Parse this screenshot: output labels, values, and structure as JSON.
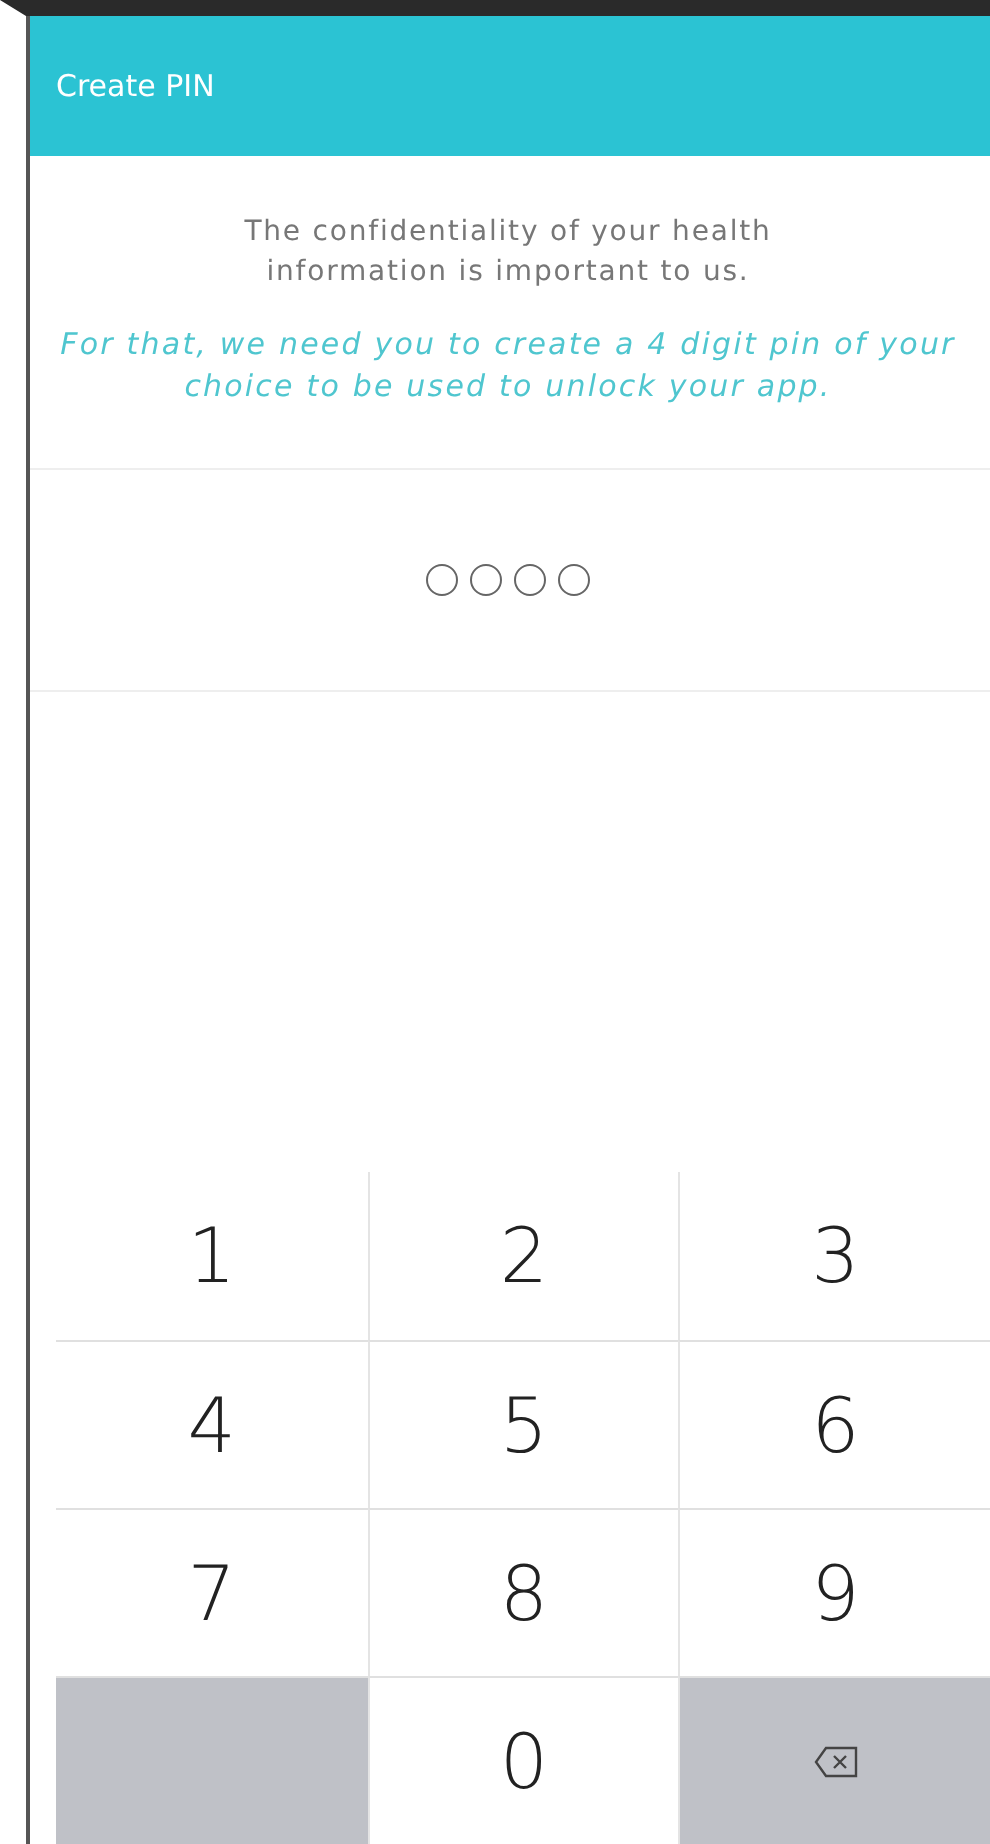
{
  "header": {
    "title": "Create PIN"
  },
  "intro": "The confidentiality of your health information is important to us.",
  "instruction": "For that, we need you to create a 4 digit pin of your choice to be used to unlock your app.",
  "pin_dots": [
    {
      "filled": false
    },
    {
      "filled": false
    },
    {
      "filled": false
    },
    {
      "filled": false
    }
  ],
  "keypad": [
    {
      "kind": "digit",
      "label": "1"
    },
    {
      "kind": "digit",
      "label": "2"
    },
    {
      "kind": "digit",
      "label": "3"
    },
    {
      "kind": "digit",
      "label": "4"
    },
    {
      "kind": "digit",
      "label": "5"
    },
    {
      "kind": "digit",
      "label": "6"
    },
    {
      "kind": "digit",
      "label": "7"
    },
    {
      "kind": "digit",
      "label": "8"
    },
    {
      "kind": "digit",
      "label": "9"
    },
    {
      "kind": "blank"
    },
    {
      "kind": "digit",
      "label": "0"
    },
    {
      "kind": "backspace"
    }
  ]
}
